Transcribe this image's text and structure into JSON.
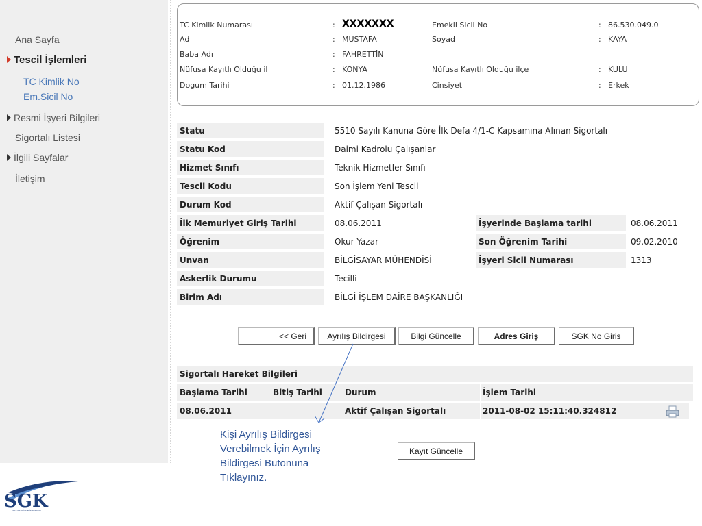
{
  "sidebar": {
    "items": [
      {
        "label": "Ana Sayfa"
      },
      {
        "label": "Tescil İşlemleri"
      },
      {
        "label": "TC Kimlik No"
      },
      {
        "label": "Em.Sicil No"
      },
      {
        "label": "Resmi İşyeri Bilgileri"
      },
      {
        "label": "Sigortalı Listesi"
      },
      {
        "label": "İlgili Sayfalar"
      },
      {
        "label": "İletişim"
      }
    ]
  },
  "person": {
    "tc_label": "TC Kimlik Numarası",
    "tc_value": "XXXXXXX",
    "emekli_label": "Emekli Sicil No",
    "emekli_value": "86.530.049.0",
    "ad_label": "Ad",
    "ad_value": "MUSTAFA",
    "soyad_label": "Soyad",
    "soyad_value": "KAYA",
    "baba_label": "Baba Adı",
    "baba_value": "FAHRETTİN",
    "il_label": "Nüfusa Kayıtlı Olduğu il",
    "il_value": "KONYA",
    "ilce_label": "Nüfusa Kayıtlı Olduğu ilçe",
    "ilce_value": "KULU",
    "dogum_label": "Dogum Tarihi",
    "dogum_value": "01.12.1986",
    "cinsiyet_label": "Cinsiyet",
    "cinsiyet_value": "Erkek",
    "sep": ":"
  },
  "details": {
    "rows": [
      {
        "label": "Statu",
        "value": "5510 Sayılı Kanuna Göre İlk Defa 4/1-C Kapsamına Alınan Sigortalı"
      },
      {
        "label": "Statu Kod",
        "value": "Daimi Kadrolu Çalışanlar"
      },
      {
        "label": "Hizmet Sınıfı",
        "value": "Teknik Hizmetler Sınıfı"
      },
      {
        "label": "Tescil Kodu",
        "value": "Son İşlem Yeni Tescil"
      },
      {
        "label": "Durum Kod",
        "value": "Aktif Çalışan Sigortalı"
      },
      {
        "label": "İlk Memuriyet Giriş Tarihi",
        "value": "08.06.2011",
        "label2": "İşyerinde Başlama tarihi",
        "value2": "08.06.2011"
      },
      {
        "label": "Öğrenim",
        "value": "Okur Yazar",
        "label2": "Son Öğrenim Tarihi",
        "value2": "09.02.2010"
      },
      {
        "label": "Unvan",
        "value": "BİLGİSAYAR MÜHENDİSİ",
        "label2": "İşyeri Sicil Numarası",
        "value2": "1313"
      },
      {
        "label": "Askerlik Durumu",
        "value": "Tecilli"
      },
      {
        "label": "Birim Adı",
        "value": "BİLGİ İŞLEM DAİRE BAŞKANLIĞI"
      }
    ]
  },
  "buttons": {
    "back": "<< Geri",
    "ayrilis": "Ayrılış Bildirgesi",
    "guncelle": "Bilgi Güncelle",
    "adres": "Adres Giriş",
    "sgkno": "SGK No Giris",
    "kayit": "Kayıt Güncelle"
  },
  "movements": {
    "title": "Sigortalı Hareket Bilgileri",
    "headers": [
      "Başlama Tarihi",
      "Bitiş Tarihi",
      "Durum",
      "İşlem Tarihi"
    ],
    "rows": [
      {
        "baslama": "08.06.2011",
        "bitis": "",
        "durum": "Aktif Çalışan Sigortalı",
        "islem": "2011-08-02 15:11:40.324812"
      }
    ]
  },
  "annotation": {
    "lines": [
      "Kişi Ayrılış Bildirgesi",
      "Verebilmek İçin Ayrılış",
      "Bildirgesi Butonuna",
      "Tıklayınız."
    ]
  },
  "logo": {
    "text": "SGK",
    "subtext": "SOSYAL GÜVENLİK KURUMU"
  },
  "colors": {
    "accent_red": "#d23b2a",
    "link_blue": "#4a78b8",
    "annotation_blue": "#2f5597",
    "row_gray": "#efefef"
  }
}
